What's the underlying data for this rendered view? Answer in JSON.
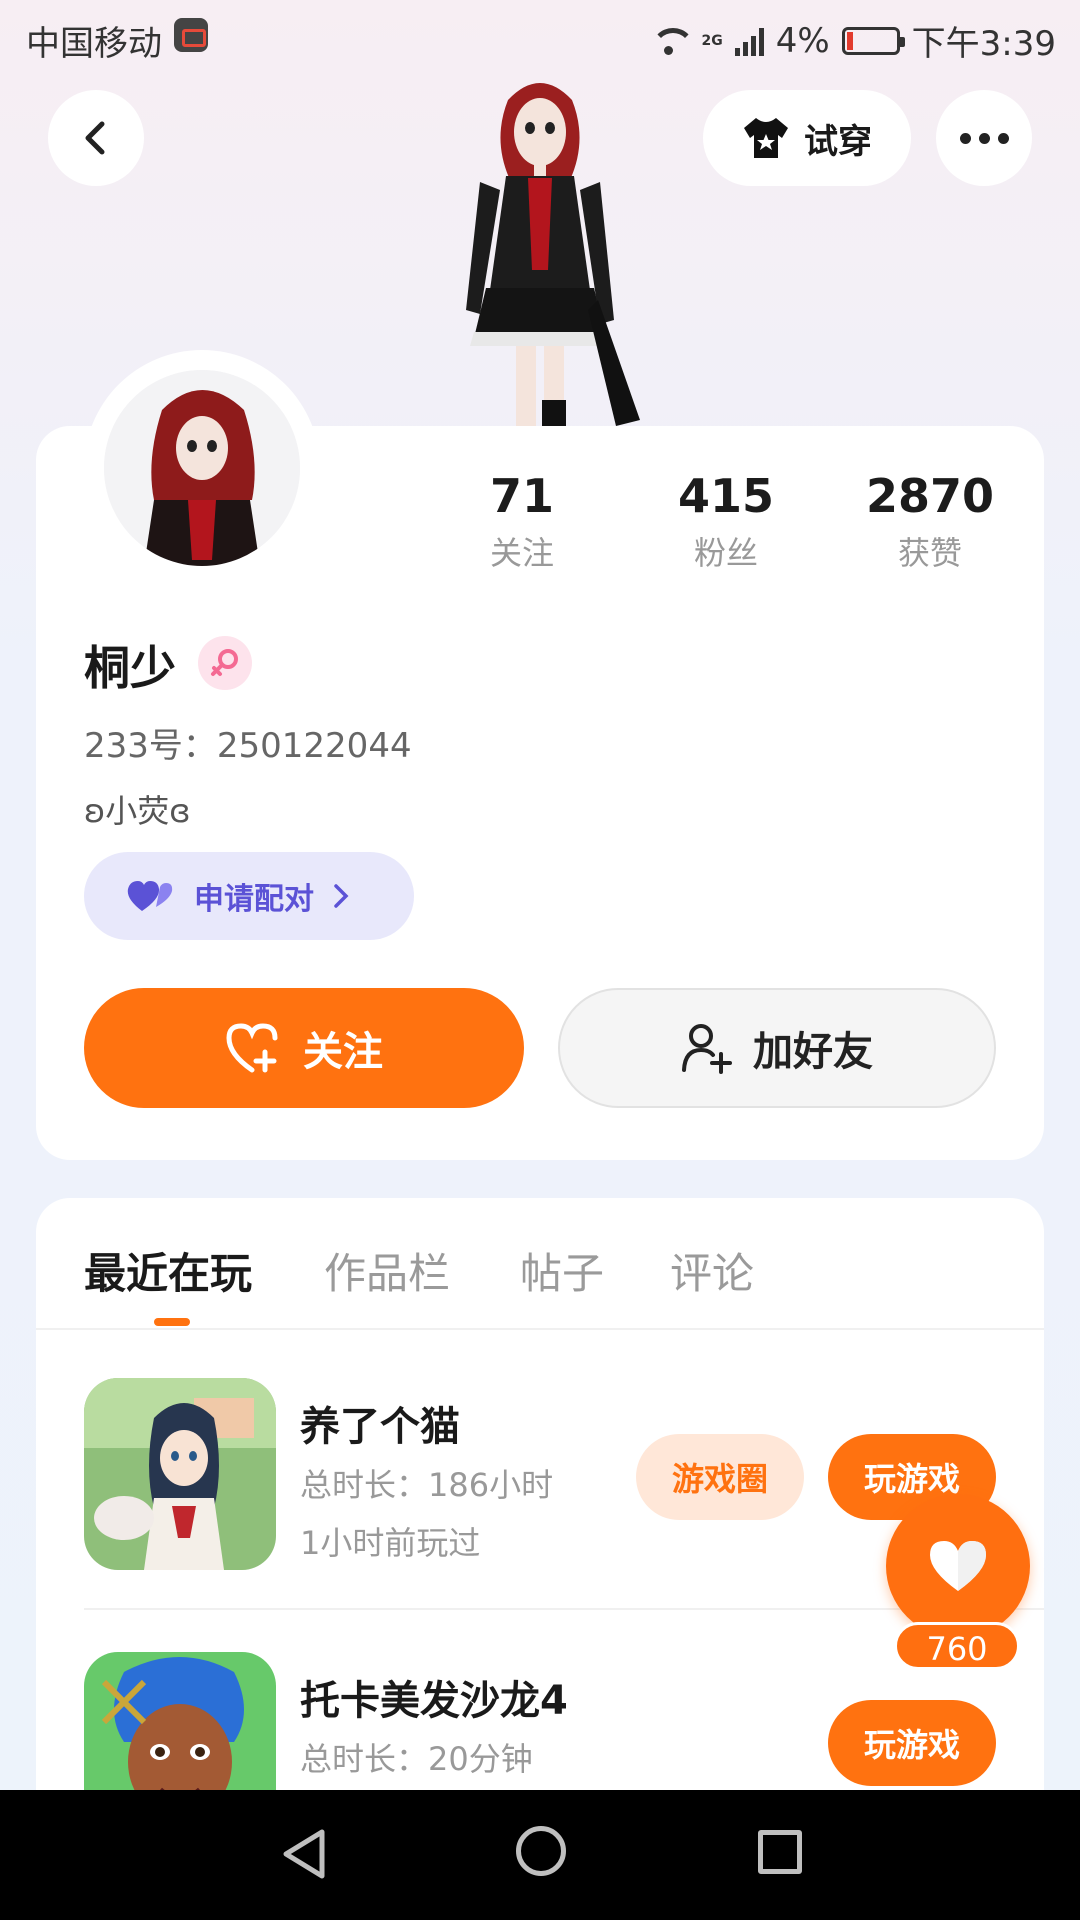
{
  "status_bar": {
    "carrier": "中国移动",
    "network": "2G",
    "battery": "4%",
    "time": "下午3:39"
  },
  "header": {
    "try_on_label": "试穿"
  },
  "profile": {
    "stats": [
      {
        "value": "71",
        "label": "关注"
      },
      {
        "value": "415",
        "label": "粉丝"
      },
      {
        "value": "2870",
        "label": "获赞"
      }
    ],
    "username": "桐少",
    "id_text": "233号：250122044",
    "bio": "ʚ小荧ɞ",
    "pair_label": "申请配对",
    "follow_label": "关注",
    "add_friend_label": "加好友"
  },
  "tabs": [
    {
      "label": "最近在玩"
    },
    {
      "label": "作品栏"
    },
    {
      "label": "帖子"
    },
    {
      "label": "评论"
    }
  ],
  "games": [
    {
      "title": "养了个猫",
      "duration": "总时长：186小时",
      "last_played": "1小时前玩过",
      "circle_label": "游戏圈",
      "play_label": "玩游戏"
    },
    {
      "title": "托卡美发沙龙4",
      "duration": "总时长：20分钟",
      "last_played": "",
      "play_label": "玩游戏"
    }
  ],
  "floating_like": {
    "count": "760"
  },
  "colors": {
    "accent": "#ff7210",
    "pair_text": "#5b52d6",
    "pair_bg": "#e8e8fb"
  }
}
